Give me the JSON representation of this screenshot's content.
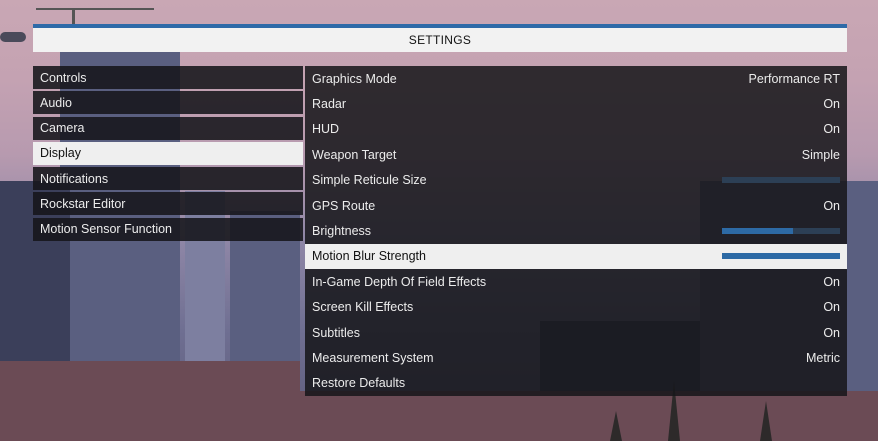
{
  "header": {
    "title": "SETTINGS"
  },
  "menu": {
    "items": [
      {
        "label": "Controls",
        "active": false
      },
      {
        "label": "Audio",
        "active": false
      },
      {
        "label": "Camera",
        "active": false
      },
      {
        "label": "Display",
        "active": true
      },
      {
        "label": "Notifications",
        "active": false
      },
      {
        "label": "Rockstar Editor",
        "active": false
      },
      {
        "label": "Motion Sensor Function",
        "active": false
      }
    ]
  },
  "settings": {
    "rows": [
      {
        "label": "Graphics Mode",
        "value": "Performance RT"
      },
      {
        "label": "Radar",
        "value": "On"
      },
      {
        "label": "HUD",
        "value": "On"
      },
      {
        "label": "Weapon Target",
        "value": "Simple"
      },
      {
        "label": "Simple Reticule Size",
        "slider": 0.0
      },
      {
        "label": "GPS Route",
        "value": "On"
      },
      {
        "label": "Brightness",
        "slider": 0.6
      },
      {
        "label": "Motion Blur Strength",
        "slider": 1.0,
        "active": true
      },
      {
        "label": "In-Game Depth Of Field Effects",
        "value": "On"
      },
      {
        "label": "Screen Kill Effects",
        "value": "On"
      },
      {
        "label": "Subtitles",
        "value": "On"
      },
      {
        "label": "Measurement System",
        "value": "Metric"
      },
      {
        "label": "Restore Defaults"
      }
    ]
  },
  "colors": {
    "accent": "#2d6aa5",
    "header_bg": "#f2f2f2",
    "panel_bg": "#16161a"
  }
}
